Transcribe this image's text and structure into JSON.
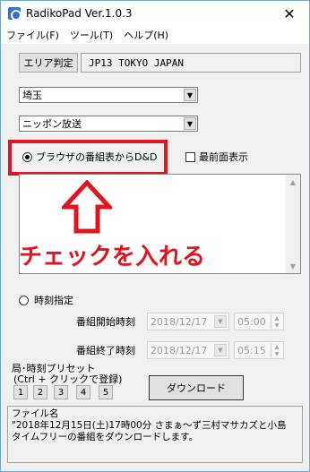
{
  "window": {
    "title": "RadikoPad Ver.1.0.3",
    "close_glyph": "✕"
  },
  "menu": [
    {
      "label": "ファイル(F)"
    },
    {
      "label": "ツール(T)"
    },
    {
      "label": "ヘルプ(H)"
    }
  ],
  "area": {
    "button_label": "エリア判定",
    "location": "JP13  TOKYO JAPAN"
  },
  "prefecture_combo": {
    "value": "埼玉"
  },
  "station_combo": {
    "value": "ニッポン放送"
  },
  "browser_dnd_radio": {
    "label": "ブラウザの番組表からD&D",
    "checked": true
  },
  "topmost_checkbox": {
    "label": "最前面表示",
    "checked": false
  },
  "annotation": {
    "text": "チェックを入れる",
    "color": "#e0151f"
  },
  "time_spec_radio": {
    "label": "時刻指定",
    "checked": false
  },
  "start": {
    "label": "番組開始時刻",
    "date": "2018/12/17",
    "time": "05:00"
  },
  "end": {
    "label": "番組終了時刻",
    "date": "2018/12/17",
    "time": "05:15"
  },
  "preset": {
    "title": "局･時刻プリセット",
    "subtitle": "(Ctrl + クリックで登録)",
    "buttons": [
      "1",
      "2",
      "3",
      "4",
      "5"
    ]
  },
  "download_button": {
    "label": "ダウンロード"
  },
  "status": {
    "lines": [
      "ファイル名",
      "\"2018年12月15日(土)17時00分 さまぁ〜ず三村マサカズと小島",
      "タイムフリーの番組をダウンロードします。"
    ]
  }
}
